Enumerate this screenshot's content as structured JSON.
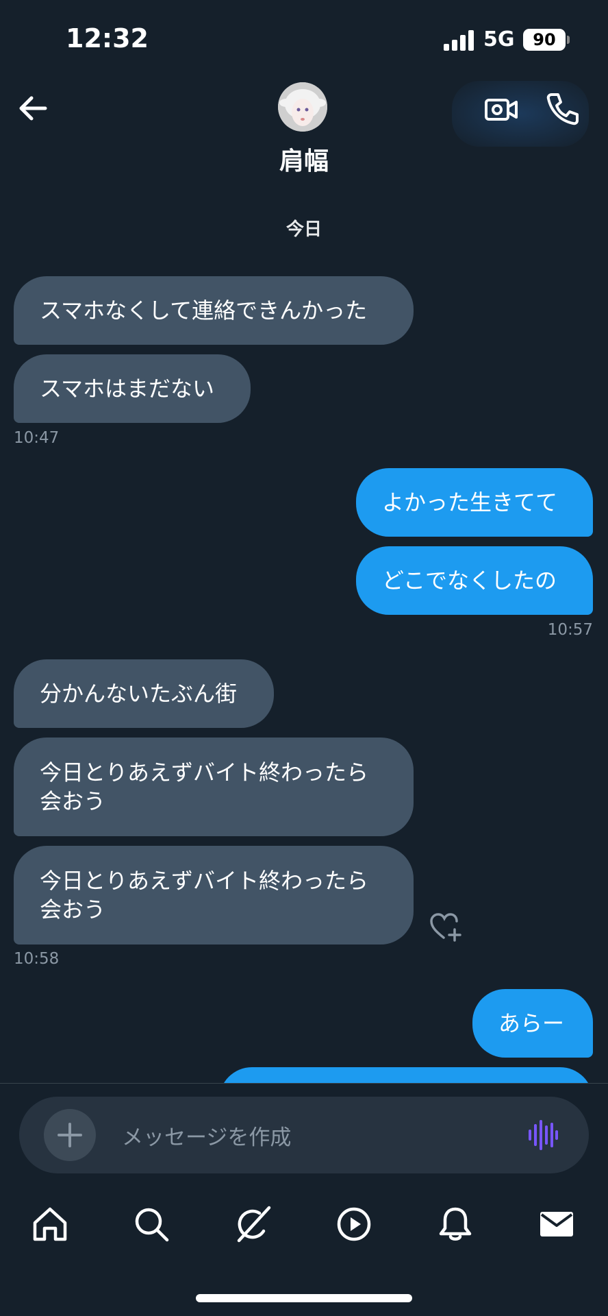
{
  "status_bar": {
    "time": "12:32",
    "network": "5G",
    "battery": "90"
  },
  "header": {
    "title": "肩幅",
    "back_icon": "arrow-left-icon",
    "video_icon": "video-camera-icon",
    "phone_icon": "phone-icon"
  },
  "date_separator": "今日",
  "messages": [
    {
      "side": "received",
      "text": "スマホなくして連絡できんかった"
    },
    {
      "side": "received",
      "text": "スマホはまだない"
    },
    {
      "timestamp": "10:47"
    },
    {
      "side": "sent",
      "text": "よかった生きてて"
    },
    {
      "side": "sent",
      "text": "どこでなくしたの"
    },
    {
      "timestamp": "10:57"
    },
    {
      "side": "received",
      "text": "分かんないたぶん街"
    },
    {
      "side": "received",
      "text": "今日とりあえずバイト終わったら会おう"
    },
    {
      "side": "received",
      "text": "今日とりあえずバイト終わったら会おう"
    },
    {
      "timestamp": "10:58"
    },
    {
      "side": "sent",
      "text": "あらー"
    }
  ],
  "composer": {
    "placeholder": "メッセージを作成"
  },
  "nav": [
    "home-icon",
    "search-icon",
    "grok-icon",
    "play-icon",
    "bell-icon",
    "mail-icon"
  ],
  "colors": {
    "background": "#15202b",
    "sent_bubble": "#1d9bf0",
    "received_bubble": "#425466",
    "voice_accent": "#7856ff"
  }
}
